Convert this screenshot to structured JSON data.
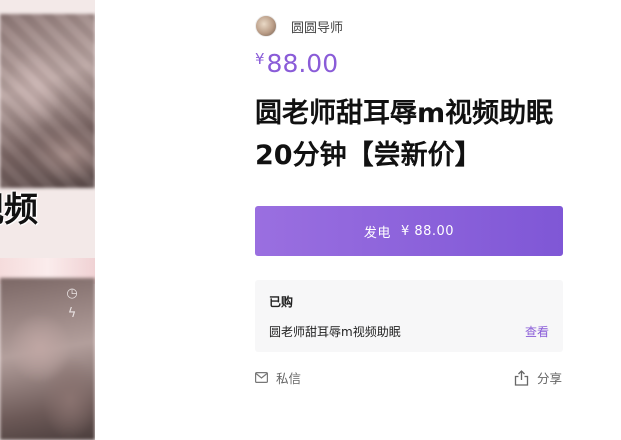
{
  "cover": {
    "caption": "视频"
  },
  "author": {
    "name": "圆圆导师"
  },
  "product": {
    "price_symbol": "¥",
    "price": "88.00",
    "title": "圆老师甜耳辱m视频助眠20分钟【尝新价】"
  },
  "buy": {
    "label": "发电",
    "price": "¥ 88.00"
  },
  "purchased": {
    "label": "已购",
    "item": "圆老师甜耳辱m视频助眠",
    "view_label": "查看"
  },
  "actions": {
    "message_label": "私信",
    "share_label": "分享"
  },
  "colors": {
    "accent": "#8a5cd8",
    "button_start": "#9a6fe0",
    "button_end": "#7f57d6"
  }
}
